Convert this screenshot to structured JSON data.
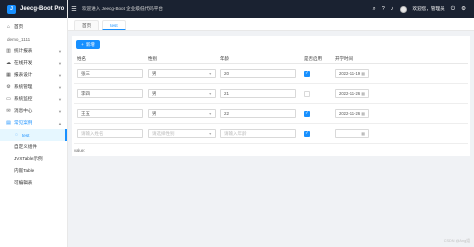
{
  "app": {
    "logo_text": "Jeecg-Boot Pro",
    "logo_mark": "J"
  },
  "header": {
    "welcome": "欢迎进入 Jeecg-Boot 企业级低代码平台",
    "user_label": "欢迎您，管理员"
  },
  "sidebar": {
    "items": [
      {
        "label": "首页",
        "icon": "home-icon",
        "glyph": "⌂"
      },
      {
        "label": "demo_1111",
        "icon": "",
        "glyph": ""
      },
      {
        "label": "统计报表",
        "icon": "chart-icon",
        "glyph": "▥"
      },
      {
        "label": "在线开发",
        "icon": "cloud-icon",
        "glyph": "☁"
      },
      {
        "label": "报表设计",
        "icon": "report-icon",
        "glyph": "▦"
      },
      {
        "label": "系统管理",
        "icon": "setting-icon",
        "glyph": "⚙"
      },
      {
        "label": "系统监控",
        "icon": "monitor-icon",
        "glyph": "▭"
      },
      {
        "label": "消息中心",
        "icon": "message-icon",
        "glyph": "✉"
      },
      {
        "label": "常见案例",
        "icon": "case-icon",
        "glyph": "▤"
      }
    ],
    "sub_items": [
      {
        "label": "test",
        "active": true,
        "glyph": "◌"
      },
      {
        "label": "自定义组件",
        "active": false,
        "glyph": ""
      },
      {
        "label": "JVXTable示例",
        "active": false,
        "glyph": ""
      },
      {
        "label": "内嵌Table",
        "active": false,
        "glyph": ""
      },
      {
        "label": "可编辑表",
        "active": false,
        "glyph": ""
      }
    ]
  },
  "tabs": [
    {
      "label": "首页",
      "active": false
    },
    {
      "label": "test",
      "active": true
    }
  ],
  "toolbar": {
    "add_label": "新增",
    "add_icon": "plus-icon"
  },
  "table": {
    "columns": [
      "姓名",
      "性别",
      "年龄",
      "是否启用",
      "开学时间"
    ],
    "rows": [
      {
        "name": "张三",
        "sex": "男",
        "age": "20",
        "enabled": true,
        "date": "2022-11-19"
      },
      {
        "name": "李四",
        "sex": "男",
        "age": "21",
        "enabled": false,
        "date": "2022-11-26"
      },
      {
        "name": "王五",
        "sex": "男",
        "age": "22",
        "enabled": true,
        "date": "2022-11-26"
      }
    ],
    "empty_row": {
      "name_placeholder": "请输入姓名",
      "sex_placeholder": "请选择性别",
      "age_placeholder": "请输入年龄",
      "enabled": true
    },
    "value_label": "value:"
  },
  "footer": {
    "credit": "CSDN @Ang姐"
  },
  "colors": {
    "primary": "#1890ff",
    "header_bg": "#1a2231"
  }
}
